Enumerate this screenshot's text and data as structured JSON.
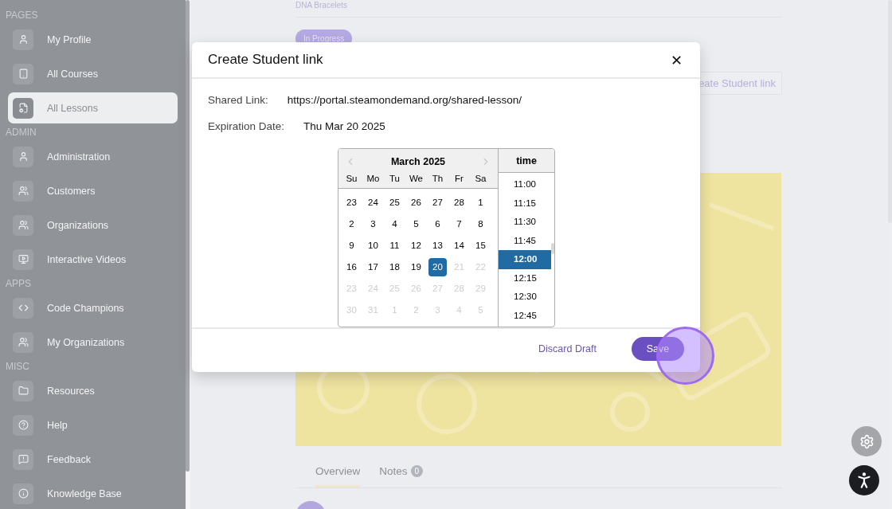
{
  "sidebar": {
    "sections": [
      {
        "title": "PAGES",
        "items": [
          {
            "label": "My Profile",
            "selected": false
          },
          {
            "label": "All Courses",
            "selected": false
          },
          {
            "label": "All Lessons",
            "selected": true
          }
        ]
      },
      {
        "title": "ADMIN",
        "items": [
          {
            "label": "Administration",
            "selected": false
          },
          {
            "label": "Customers",
            "selected": false
          },
          {
            "label": "Organizations",
            "selected": false
          },
          {
            "label": "Interactive Videos",
            "selected": false
          }
        ]
      },
      {
        "title": "APPS",
        "items": [
          {
            "label": "Code Champions",
            "selected": false
          },
          {
            "label": "My Organizations",
            "selected": false
          }
        ]
      },
      {
        "title": "MISC",
        "items": [
          {
            "label": "Resources",
            "selected": false
          },
          {
            "label": "Help",
            "selected": false
          },
          {
            "label": "Feedback",
            "selected": false
          },
          {
            "label": "Knowledge Base",
            "selected": false
          }
        ]
      }
    ]
  },
  "lesson": {
    "breadcrumb": "DNA Bracelets",
    "status_badge": "In Progress",
    "share_button": "eate Student link",
    "tabs": [
      {
        "label": "Overview",
        "selected": true
      },
      {
        "label": "Notes",
        "selected": false,
        "count": "0"
      }
    ]
  },
  "dialog": {
    "title": "Create Student link",
    "close": "✕",
    "fields": [
      {
        "label": "Shared Link:",
        "value": "https://portal.steamondemand.org/shared-lesson/"
      },
      {
        "label": "Expiration Date:",
        "value": "Thu Mar 20 2025"
      }
    ],
    "calendar": {
      "month": "March 2025",
      "weekdays": [
        "Su",
        "Mo",
        "Tu",
        "We",
        "Th",
        "Fr",
        "Sa"
      ],
      "weeks": [
        [
          {
            "day": "23",
            "disabled": false,
            "selected": false
          },
          {
            "day": "24",
            "disabled": false,
            "selected": false
          },
          {
            "day": "25",
            "disabled": false,
            "selected": false
          },
          {
            "day": "26",
            "disabled": false,
            "selected": false
          },
          {
            "day": "27",
            "disabled": false,
            "selected": false
          },
          {
            "day": "28",
            "disabled": false,
            "selected": false
          },
          {
            "day": "1",
            "disabled": false,
            "selected": false
          }
        ],
        [
          {
            "day": "2",
            "disabled": false,
            "selected": false
          },
          {
            "day": "3",
            "disabled": false,
            "selected": false
          },
          {
            "day": "4",
            "disabled": false,
            "selected": false
          },
          {
            "day": "5",
            "disabled": false,
            "selected": false
          },
          {
            "day": "6",
            "disabled": false,
            "selected": false
          },
          {
            "day": "7",
            "disabled": false,
            "selected": false
          },
          {
            "day": "8",
            "disabled": false,
            "selected": false
          }
        ],
        [
          {
            "day": "9",
            "disabled": false,
            "selected": false
          },
          {
            "day": "10",
            "disabled": false,
            "selected": false
          },
          {
            "day": "11",
            "disabled": false,
            "selected": false
          },
          {
            "day": "12",
            "disabled": false,
            "selected": false
          },
          {
            "day": "13",
            "disabled": false,
            "selected": false
          },
          {
            "day": "14",
            "disabled": false,
            "selected": false
          },
          {
            "day": "15",
            "disabled": false,
            "selected": false
          }
        ],
        [
          {
            "day": "16",
            "disabled": false,
            "selected": false
          },
          {
            "day": "17",
            "disabled": false,
            "selected": false
          },
          {
            "day": "18",
            "disabled": false,
            "selected": false
          },
          {
            "day": "19",
            "disabled": false,
            "selected": false
          },
          {
            "day": "20",
            "disabled": false,
            "selected": true
          },
          {
            "day": "21",
            "disabled": true,
            "selected": false
          },
          {
            "day": "22",
            "disabled": true,
            "selected": false
          }
        ],
        [
          {
            "day": "23",
            "disabled": true,
            "selected": false
          },
          {
            "day": "24",
            "disabled": true,
            "selected": false
          },
          {
            "day": "25",
            "disabled": true,
            "selected": false
          },
          {
            "day": "26",
            "disabled": true,
            "selected": false
          },
          {
            "day": "27",
            "disabled": true,
            "selected": false
          },
          {
            "day": "28",
            "disabled": true,
            "selected": false
          },
          {
            "day": "29",
            "disabled": true,
            "selected": false
          }
        ],
        [
          {
            "day": "30",
            "disabled": true,
            "selected": false
          },
          {
            "day": "31",
            "disabled": true,
            "selected": false
          },
          {
            "day": "1",
            "disabled": true,
            "selected": false
          },
          {
            "day": "2",
            "disabled": true,
            "selected": false
          },
          {
            "day": "3",
            "disabled": true,
            "selected": false
          },
          {
            "day": "4",
            "disabled": true,
            "selected": false
          },
          {
            "day": "5",
            "disabled": true,
            "selected": false
          }
        ]
      ],
      "time_header": "time",
      "times": [
        {
          "label": "11:00",
          "selected": false
        },
        {
          "label": "11:15",
          "selected": false
        },
        {
          "label": "11:30",
          "selected": false
        },
        {
          "label": "11:45",
          "selected": false
        },
        {
          "label": "12:00",
          "selected": true
        },
        {
          "label": "12:15",
          "selected": false
        },
        {
          "label": "12:30",
          "selected": false
        },
        {
          "label": "12:45",
          "selected": false
        }
      ]
    },
    "buttons": {
      "discard": "Discard Draft",
      "save": "Save"
    }
  }
}
